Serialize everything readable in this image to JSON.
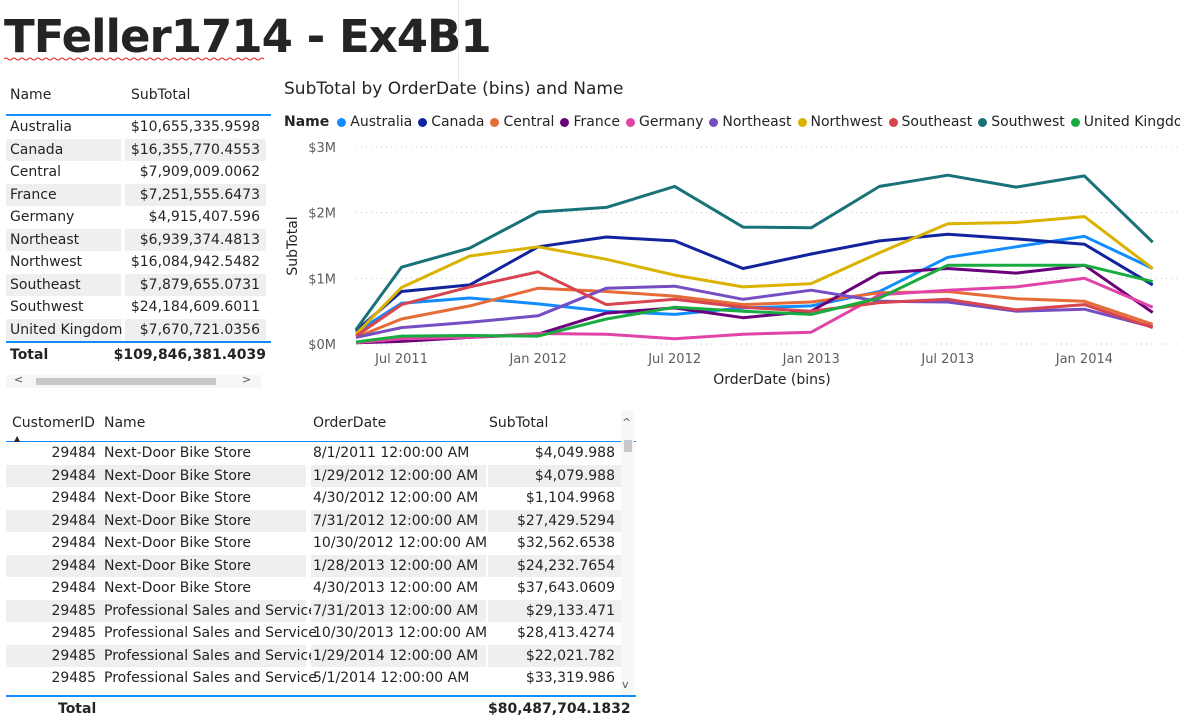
{
  "page_title": "TFeller1714 - Ex4B1",
  "summary_table": {
    "headers": [
      "Name",
      "SubTotal"
    ],
    "rows": [
      [
        "Australia",
        "$10,655,335.9598"
      ],
      [
        "Canada",
        "$16,355,770.4553"
      ],
      [
        "Central",
        "$7,909,009.0062"
      ],
      [
        "France",
        "$7,251,555.6473"
      ],
      [
        "Germany",
        "$4,915,407.596"
      ],
      [
        "Northeast",
        "$6,939,374.4813"
      ],
      [
        "Northwest",
        "$16,084,942.5482"
      ],
      [
        "Southeast",
        "$7,879,655.0731"
      ],
      [
        "Southwest",
        "$24,184,609.6011"
      ],
      [
        "United Kingdom",
        "$7,670,721.0356"
      ]
    ],
    "total_label": "Total",
    "total_value": "$109,846,381.4039",
    "scroll_left": "<",
    "scroll_right": ">"
  },
  "chart_data": {
    "type": "line",
    "title": "SubTotal by OrderDate (bins) and Name",
    "legend_title": "Name",
    "xlabel": "OrderDate (bins)",
    "ylabel": "SubTotal",
    "y_ticks": [
      "$0M",
      "$1M",
      "$2M",
      "$3M"
    ],
    "ylim": [
      0,
      3000000
    ],
    "x_ticks": [
      "Jul 2011",
      "Jan 2012",
      "Jul 2012",
      "Jan 2013",
      "Jul 2013",
      "Jan 2014"
    ],
    "x_tick_months": [
      2,
      8,
      14,
      20,
      26,
      32
    ],
    "x_months": [
      0,
      2,
      5,
      8,
      11,
      14,
      17,
      20,
      23,
      26,
      29,
      32,
      35
    ],
    "legend_position": "top-left",
    "grid": true,
    "series": [
      {
        "name": "Australia",
        "color": "#118DFF",
        "values": [
          180000,
          620000,
          700000,
          610000,
          500000,
          450000,
          550000,
          580000,
          800000,
          1320000,
          1480000,
          1640000,
          1150000
        ]
      },
      {
        "name": "Canada",
        "color": "#12239E",
        "values": [
          200000,
          800000,
          900000,
          1480000,
          1630000,
          1570000,
          1150000,
          1370000,
          1570000,
          1670000,
          1600000,
          1520000,
          900000
        ]
      },
      {
        "name": "Central",
        "color": "#E66C37",
        "values": [
          100000,
          380000,
          580000,
          850000,
          800000,
          730000,
          600000,
          640000,
          780000,
          800000,
          690000,
          650000,
          300000
        ]
      },
      {
        "name": "France",
        "color": "#6B007B",
        "values": [
          20000,
          40000,
          100000,
          150000,
          470000,
          550000,
          400000,
          500000,
          1080000,
          1150000,
          1080000,
          1200000,
          480000
        ]
      },
      {
        "name": "Germany",
        "color": "#E044A7",
        "values": [
          20000,
          80000,
          100000,
          160000,
          150000,
          80000,
          150000,
          180000,
          750000,
          820000,
          870000,
          1000000,
          560000
        ]
      },
      {
        "name": "Northeast",
        "color": "#744EC2",
        "values": [
          100000,
          250000,
          330000,
          430000,
          850000,
          880000,
          680000,
          820000,
          650000,
          640000,
          500000,
          530000,
          260000
        ]
      },
      {
        "name": "Northwest",
        "color": "#D9B300",
        "values": [
          150000,
          860000,
          1340000,
          1480000,
          1290000,
          1050000,
          870000,
          920000,
          1390000,
          1830000,
          1850000,
          1940000,
          1150000
        ]
      },
      {
        "name": "Southeast",
        "color": "#D64550",
        "values": [
          120000,
          600000,
          870000,
          1100000,
          600000,
          680000,
          560000,
          500000,
          630000,
          680000,
          520000,
          600000,
          250000
        ]
      },
      {
        "name": "Southwest",
        "color": "#197278",
        "values": [
          220000,
          1170000,
          1460000,
          2010000,
          2080000,
          2400000,
          1780000,
          1770000,
          2400000,
          2570000,
          2390000,
          2560000,
          1550000
        ]
      },
      {
        "name": "United Kingdom",
        "color": "#1AAB40",
        "values": [
          30000,
          120000,
          130000,
          120000,
          380000,
          560000,
          500000,
          450000,
          700000,
          1200000,
          1200000,
          1200000,
          950000
        ]
      }
    ]
  },
  "detail_table": {
    "headers": [
      "CustomerID",
      "Name",
      "OrderDate",
      "SubTotal"
    ],
    "rows": [
      [
        "29484",
        "Next-Door Bike Store",
        "8/1/2011 12:00:00 AM",
        "$4,049.988"
      ],
      [
        "29484",
        "Next-Door Bike Store",
        "1/29/2012 12:00:00 AM",
        "$4,079.988"
      ],
      [
        "29484",
        "Next-Door Bike Store",
        "4/30/2012 12:00:00 AM",
        "$1,104.9968"
      ],
      [
        "29484",
        "Next-Door Bike Store",
        "7/31/2012 12:00:00 AM",
        "$27,429.5294"
      ],
      [
        "29484",
        "Next-Door Bike Store",
        "10/30/2012 12:00:00 AM",
        "$32,562.6538"
      ],
      [
        "29484",
        "Next-Door Bike Store",
        "1/28/2013 12:00:00 AM",
        "$24,232.7654"
      ],
      [
        "29484",
        "Next-Door Bike Store",
        "4/30/2013 12:00:00 AM",
        "$37,643.0609"
      ],
      [
        "29485",
        "Professional Sales and Service",
        "7/31/2013 12:00:00 AM",
        "$29,133.471"
      ],
      [
        "29485",
        "Professional Sales and Service",
        "10/30/2013 12:00:00 AM",
        "$28,413.4274"
      ],
      [
        "29485",
        "Professional Sales and Service",
        "1/29/2014 12:00:00 AM",
        "$22,021.782"
      ],
      [
        "29485",
        "Professional Sales and Service",
        "5/1/2014 12:00:00 AM",
        "$33,319.986"
      ]
    ],
    "total_label": "Total",
    "total_value": "$80,487,704.1832",
    "scroll_up": "^",
    "scroll_down": "v"
  },
  "colors": {
    "accent": "#118DFF",
    "row_alt": "#EFEFEF",
    "text": "#252423"
  }
}
